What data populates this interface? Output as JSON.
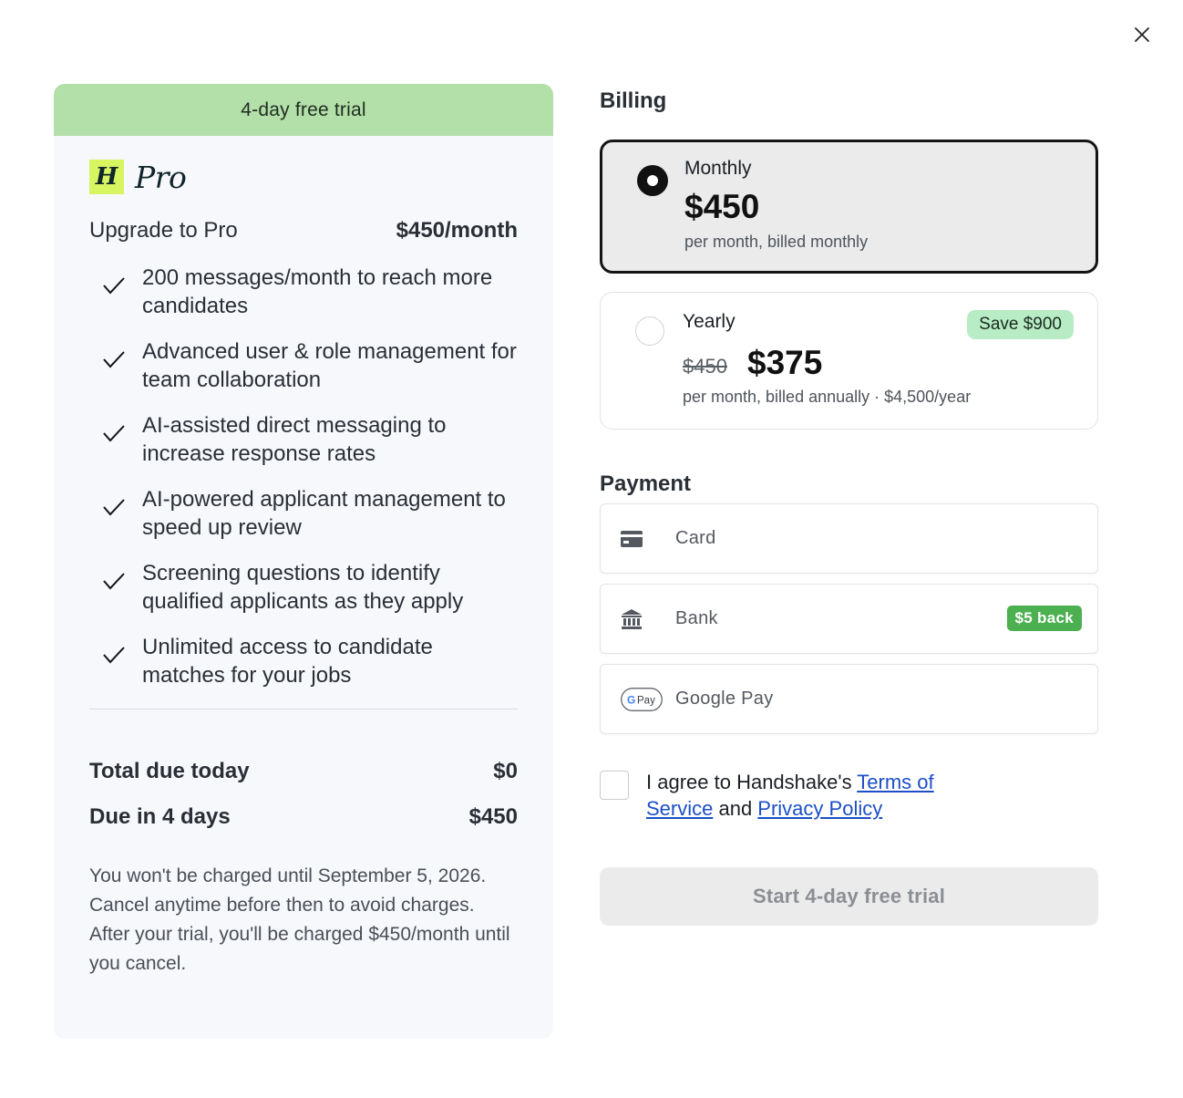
{
  "dialog": {
    "close_label": "Close"
  },
  "plan": {
    "trial_banner": "4-day free trial",
    "logo_mark": "H",
    "logo_text": "Pro",
    "upgrade_title": "Upgrade to Pro",
    "upgrade_price": "$450/month",
    "features": [
      "200 messages/month to reach more candidates",
      "Advanced user & role management for team collaboration",
      "AI-assisted direct messaging to increase response rates",
      "AI-powered applicant management to speed up review",
      "Screening questions to identify qualified applicants as they apply",
      "Unlimited access to candidate matches for your jobs"
    ],
    "total_due_label": "Total due today",
    "total_due_value": "$0",
    "due_later_label": "Due in 4 days",
    "due_later_value": "$450",
    "note": "You won't be charged until September 5, 2026. Cancel anytime before then to avoid charges. After your trial, you'll be charged $450/month until you cancel."
  },
  "billing": {
    "title": "Billing",
    "options": [
      {
        "label": "Monthly",
        "price": "$450",
        "subtitle": "per month, billed monthly",
        "selected": true
      },
      {
        "label": "Yearly",
        "old_price": "$450",
        "price": "$375",
        "subtitle": "per month, billed annually · $4,500/year",
        "badge": "Save $900",
        "selected": false
      }
    ]
  },
  "payment": {
    "title": "Payment",
    "methods": [
      {
        "label": "Card",
        "icon": "credit-card-icon"
      },
      {
        "label": "Bank",
        "icon": "bank-icon",
        "badge": "$5 back"
      },
      {
        "label": "Google Pay",
        "icon": "google-pay-icon",
        "icon_text": "Pay"
      }
    ]
  },
  "agreement": {
    "prefix": "I agree to Handshake's ",
    "terms_link": "Terms of Service",
    "middle": " and ",
    "privacy_link": "Privacy Policy"
  },
  "cta": {
    "label": "Start 4-day free trial"
  },
  "colors": {
    "trial_banner": "#b3dfa8",
    "logo_accent": "#d6f560",
    "save_badge": "#b7ecc4",
    "bank_badge": "#4caf50",
    "link": "#1c4fc7"
  }
}
